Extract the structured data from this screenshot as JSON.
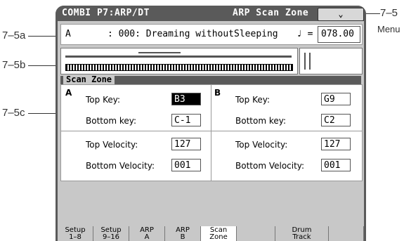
{
  "callouts": {
    "menu_num": "7–5",
    "menu_word": "Menu",
    "a": "7–5a",
    "b": "7–5b",
    "c": "7–5c"
  },
  "title": {
    "left": "COMBI P7:ARP/DT",
    "right": "ARP Scan Zone",
    "menu_glyph": "⌄"
  },
  "combi": {
    "letter": "A",
    "program": ": 000: Dreaming withoutSleeping",
    "tempo_symbol": "♩ =",
    "tempo": "078.00"
  },
  "scan_zone": {
    "title": "Scan Zone",
    "a": {
      "tag": "A",
      "top_key_label": "Top Key:",
      "top_key": "B3",
      "bottom_key_label": "Bottom key:",
      "bottom_key": "C-1",
      "top_vel_label": "Top Velocity:",
      "top_vel": "127",
      "bottom_vel_label": "Bottom Velocity:",
      "bottom_vel": "001"
    },
    "b": {
      "tag": "B",
      "top_key_label": "Top Key:",
      "top_key": "G9",
      "bottom_key_label": "Bottom key:",
      "bottom_key": "C2",
      "top_vel_label": "Top Velocity:",
      "top_vel": "127",
      "bottom_vel_label": "Bottom Velocity:",
      "bottom_vel": "001"
    }
  },
  "tabs": [
    {
      "l1": "Setup",
      "l2": "1–8"
    },
    {
      "l1": "Setup",
      "l2": "9–16"
    },
    {
      "l1": "ARP",
      "l2": "A"
    },
    {
      "l1": "ARP",
      "l2": "B"
    },
    {
      "l1": "Scan",
      "l2": "Zone"
    },
    {
      "l1": "",
      "l2": ""
    },
    {
      "l1": "Drum",
      "l2": "Track"
    },
    {
      "l1": "",
      "l2": ""
    }
  ],
  "active_tab": 4
}
